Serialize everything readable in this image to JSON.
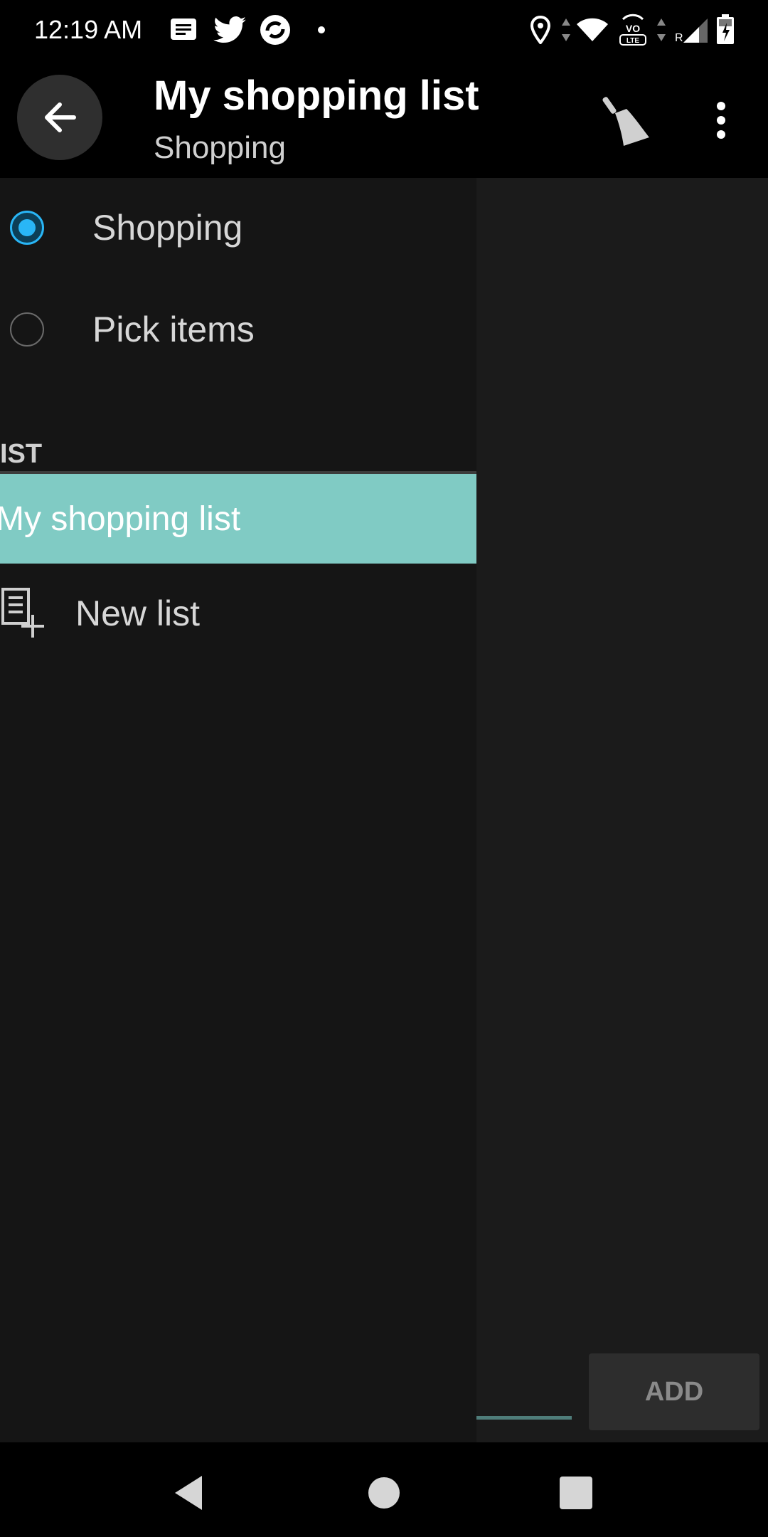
{
  "status_bar": {
    "time": "12:19 AM",
    "icons": [
      "message-icon",
      "twitter-icon",
      "sync-app-icon",
      "dot-icon",
      "location-icon",
      "data-arrows-icon",
      "wifi-icon",
      "volte-icon",
      "signal-icon",
      "battery-charging-icon"
    ],
    "volte_text": "VO LTE",
    "roaming_text": "R"
  },
  "app_bar": {
    "title": "My shopping list",
    "subtitle": "Shopping"
  },
  "drawer": {
    "modes": [
      {
        "label": "Shopping",
        "selected": true
      },
      {
        "label": "Pick items",
        "selected": false
      }
    ],
    "section_header": "IST",
    "lists": [
      {
        "label": "My shopping list",
        "active": true
      }
    ],
    "new_list_label": "New list"
  },
  "content": {
    "add_button_label": "ADD"
  },
  "colors": {
    "accent": "#80cbc4",
    "radio_selected": "#29b6f6",
    "background": "#141414"
  }
}
